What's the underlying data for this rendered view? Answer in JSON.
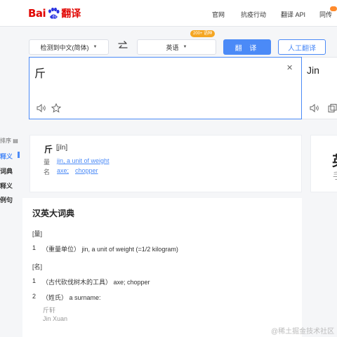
{
  "header": {
    "logo_bai": "Bai",
    "logo_fanyi": "翻译",
    "nav": [
      "官网",
      "抗疫行动",
      "翻译 API",
      "同传"
    ]
  },
  "controls": {
    "source_lang": "检测到中文(简体)",
    "target_lang": "英语",
    "tag": "200+ 语种",
    "translate_label": "翻 译",
    "human_label": "人工翻译"
  },
  "source": {
    "text": "斤"
  },
  "target": {
    "text": "Jin"
  },
  "sidebar": {
    "sort": "排序",
    "items": [
      "释义",
      "词典",
      "释义",
      "例句"
    ]
  },
  "card": {
    "word": "斤",
    "pinyin": "[jīn]",
    "rows": [
      {
        "pos": "量",
        "meanings": [
          "jin, a unit of weight"
        ]
      },
      {
        "pos": "名",
        "meanings": [
          "axe;",
          "chopper"
        ]
      }
    ]
  },
  "right_card": {
    "big": "英",
    "small": "手"
  },
  "dictionary": {
    "title": "汉英大词典",
    "sections": [
      {
        "label": "[量]",
        "entries": [
          {
            "num": "1",
            "text": "（重量单位） jin, a unit of weight (=1/2 kilogram)"
          }
        ]
      },
      {
        "label": "[名]",
        "entries": [
          {
            "num": "1",
            "text": "（古代砍伐树木的工具） axe; chopper"
          },
          {
            "num": "2",
            "text": "（姓氏） a surname:"
          }
        ]
      }
    ],
    "examples": [
      "斤轩",
      "Jin Xuan"
    ]
  },
  "watermark": "@稀土掘金技术社区",
  "colors": {
    "brand_red": "#e10602",
    "accent_blue": "#4b8af7",
    "tag_orange": "#f5a623"
  }
}
